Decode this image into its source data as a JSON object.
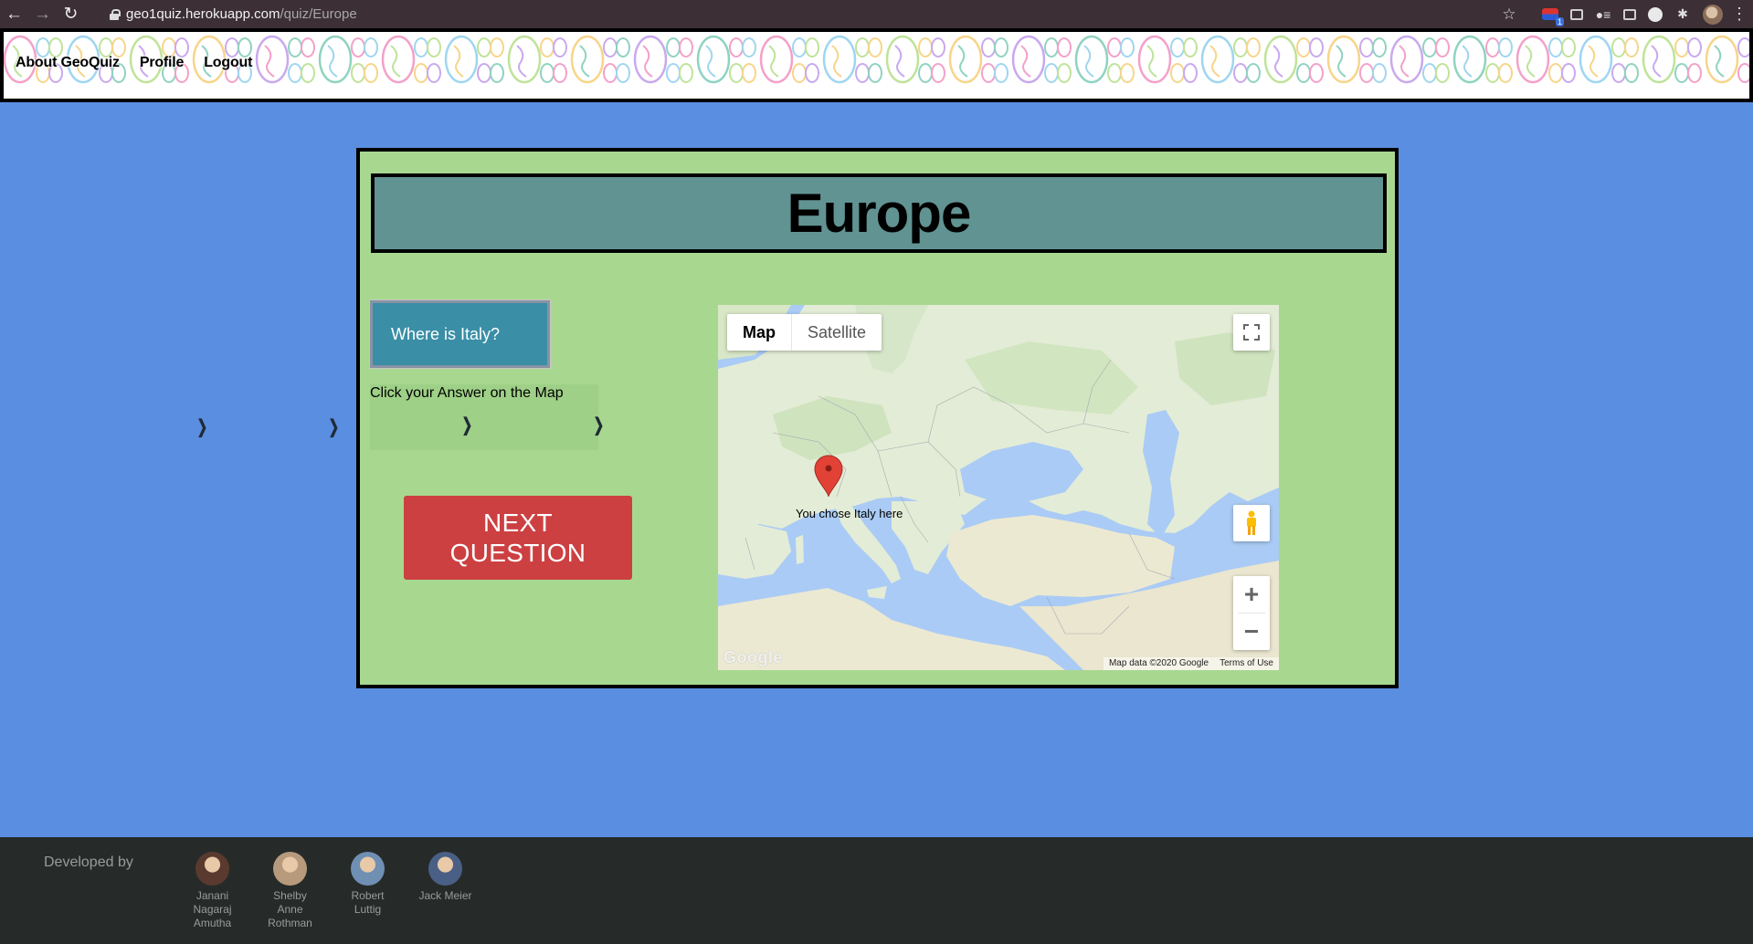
{
  "browser": {
    "url_host": "geo1quiz.herokuapp.com",
    "url_path": "/quiz/Europe"
  },
  "nav": {
    "about": "About GeoQuiz",
    "profile": "Profile",
    "logout": "Logout"
  },
  "quiz": {
    "title": "Europe",
    "question": "Where is Italy?",
    "instruction": "Click your Answer on the Map",
    "next_line1": "NEXT",
    "next_line2": "QUESTION"
  },
  "map": {
    "type_map": "Map",
    "type_satellite": "Satellite",
    "marker_label": "You chose Italy here",
    "attribution": "Map data ©2020 Google",
    "terms": "Terms of Use",
    "logo": "Google"
  },
  "footer": {
    "developed_by": "Developed by",
    "developers": [
      {
        "name": "Janani Nagaraj Amutha",
        "color": "#5a3a2e"
      },
      {
        "name": "Shelby Anne Rothman",
        "color": "#b79a7c"
      },
      {
        "name": "Robert Luttig",
        "color": "#6f8fb3"
      },
      {
        "name": "Jack Meier",
        "color": "#4a5f86"
      }
    ]
  },
  "colors": {
    "page_bg": "#5a8ee0",
    "card_bg": "#a8d890",
    "title_bg": "#629393",
    "question_bg": "#3a8ea6",
    "next_bg": "#cc4042",
    "footer_bg": "#262b29"
  }
}
